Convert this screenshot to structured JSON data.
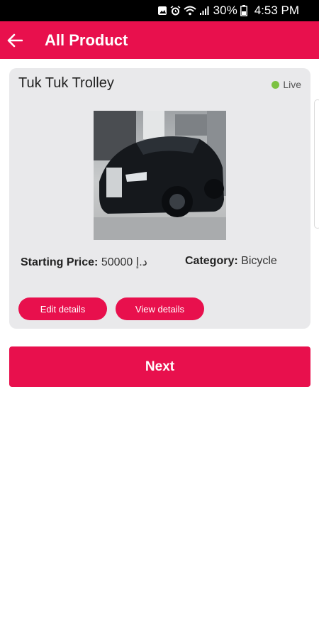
{
  "status_bar": {
    "battery_percent": "30%",
    "time": "4:53 PM",
    "icons": [
      "image-notification-icon",
      "alarm-icon",
      "wifi-icon",
      "signal-icon",
      "battery-icon"
    ]
  },
  "app_bar": {
    "title": "All Product",
    "back_icon": "arrow-left-icon",
    "background": "#e8104d"
  },
  "product": {
    "name": "Tuk Tuk Trolley",
    "status": "Live",
    "status_color": "#7cc242",
    "image_subject": "black luxury car",
    "price_label": "Starting Price:",
    "price_value": "50000 د.إ",
    "category_label": "Category:",
    "category_value": "Bicycle",
    "edit_label": "Edit details",
    "view_label": "View details"
  },
  "footer": {
    "next_label": "Next"
  },
  "colors": {
    "accent": "#e8104d",
    "card_bg": "#e9e9eb"
  }
}
